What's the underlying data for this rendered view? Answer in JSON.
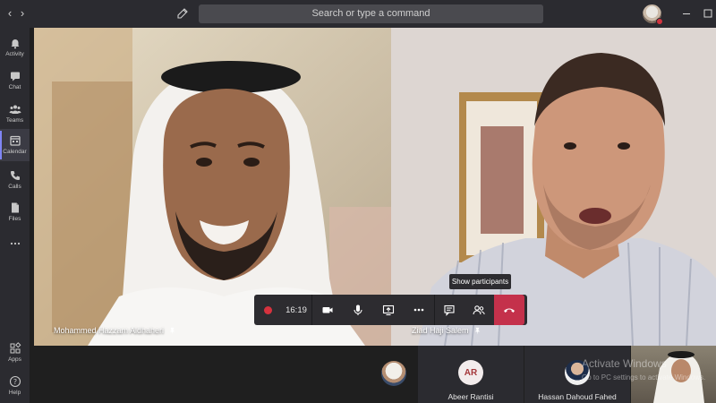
{
  "topbar": {
    "back_icon": "chevron-left-icon",
    "forward_icon": "chevron-right-icon",
    "compose_icon": "compose-icon",
    "search_placeholder": "Search or type a command",
    "window_controls": [
      "minimize-icon",
      "maximize-icon"
    ]
  },
  "rail": {
    "items": [
      {
        "label": "Activity",
        "icon": "bell-icon"
      },
      {
        "label": "Chat",
        "icon": "chat-icon"
      },
      {
        "label": "Teams",
        "icon": "teams-icon"
      },
      {
        "label": "Calendar",
        "icon": "calendar-icon",
        "active": true
      },
      {
        "label": "Calls",
        "icon": "phone-icon"
      },
      {
        "label": "Files",
        "icon": "file-icon"
      },
      {
        "label": "",
        "icon": "more-icon"
      }
    ],
    "bottom_items": [
      {
        "label": "Apps",
        "icon": "apps-icon"
      },
      {
        "label": "Help",
        "icon": "help-icon"
      }
    ]
  },
  "tiles": {
    "left_name": "Mohammed Hazzam Aldhaheri",
    "right_name": "Ziad Haji Salem"
  },
  "controls": {
    "timer": "16:19",
    "tooltip": "Show participants"
  },
  "participants": [
    {
      "name": "",
      "initials": ""
    },
    {
      "name": "Abeer Rantisi",
      "initials": "AR"
    },
    {
      "name": "Hassan Dahoud Fahed",
      "initials": ""
    },
    {
      "name": "",
      "initials": ""
    }
  ],
  "watermark": {
    "line1": "Activate Windows",
    "line2": "Go to PC settings to activate Windows."
  },
  "colors": {
    "accent": "#7f85f5",
    "hangup": "#c4314b",
    "record": "#d6323e",
    "status_busy": "#d1343f"
  }
}
